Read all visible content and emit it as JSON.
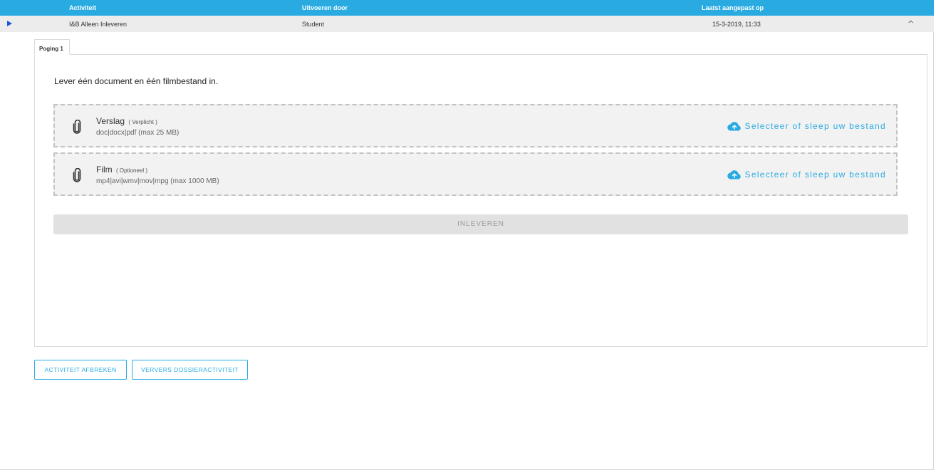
{
  "table": {
    "headers": {
      "activity": "Activiteit",
      "performed_by": "Uitvoeren door",
      "last_modified": "Laatst aangepast op"
    },
    "row": {
      "activity": "I&B Alleen Inleveren",
      "performed_by": "Student",
      "last_modified": "15-3-2019, 11:33",
      "collapse_glyph": "^"
    }
  },
  "tabs": [
    {
      "label": "Poging 1",
      "active": true
    }
  ],
  "panel": {
    "intro": "Lever één document en één filmbestand in.",
    "uploads": [
      {
        "title": "Verslag",
        "tag": "( Verplicht )",
        "types": "doc|docx|pdf (max 25 MB)",
        "action": "Selecteer of sleep uw bestand",
        "icon": "paperclip-icon"
      },
      {
        "title": "Film",
        "tag": "( Optioneel )",
        "types": "mp4|avi|wmv|mov|mpg (max 1000 MB)",
        "action": "Selecteer of sleep uw bestand",
        "icon": "paperclip-icon"
      }
    ],
    "submit_label": "INLEVEREN"
  },
  "actions": {
    "cancel_label": "ACTIVITEIT AFBREKEN",
    "refresh_label": "VERVERS DOSSIERACTIVITEIT"
  },
  "colors": {
    "accent": "#29abe2",
    "row_bg": "#ececec",
    "dropzone_bg": "#f2f2f2",
    "disabled_button": "#e1e1e1",
    "expand_arrow": "#1a56db"
  }
}
